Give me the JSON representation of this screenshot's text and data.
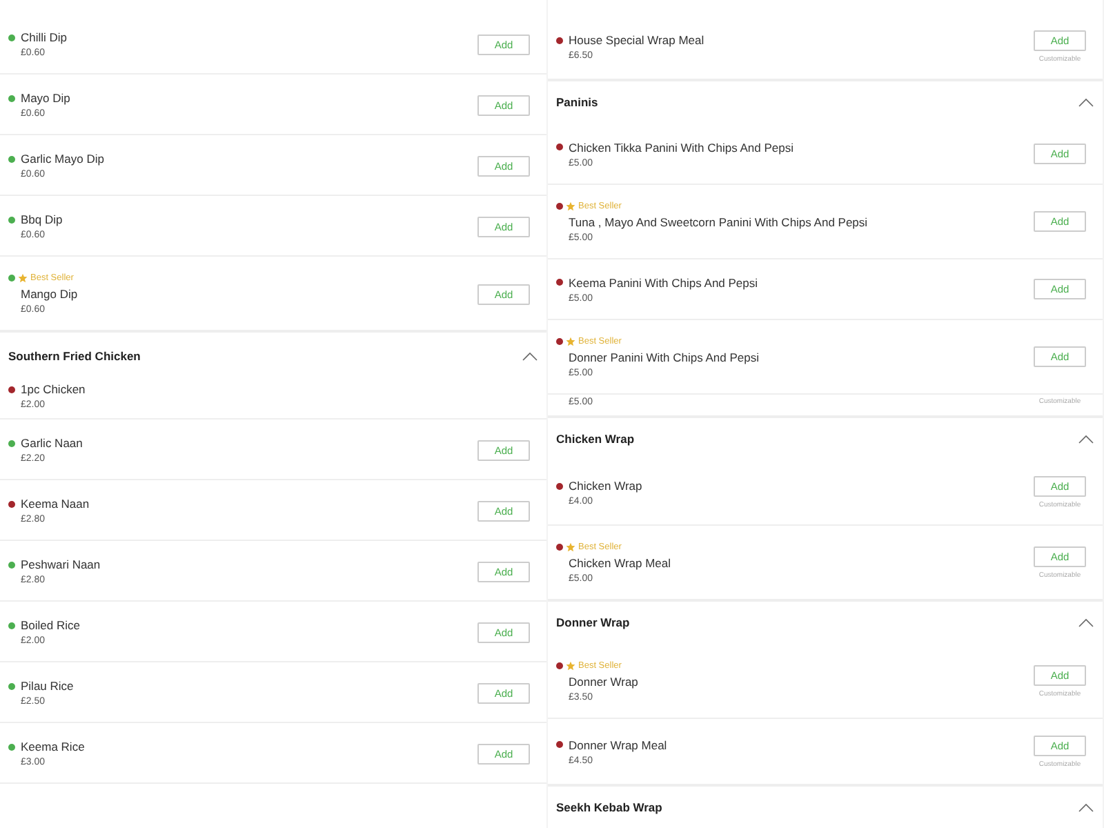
{
  "columns": [
    {
      "entries": [
        {
          "kind": "item",
          "name": "Chilli Dip",
          "price": "£0.60",
          "color": "#4caf50",
          "best_seller": false,
          "button": "Add"
        },
        {
          "kind": "item",
          "name": "Mayo Dip",
          "price": "£0.60",
          "color": "#4caf50",
          "best_seller": false,
          "button": "Add"
        },
        {
          "kind": "item",
          "name": "Garlic Mayo Dip",
          "price": "£0.60",
          "color": "#4caf50",
          "best_seller": false,
          "button": "Add"
        },
        {
          "kind": "item",
          "name": "Bbq Dip",
          "price": "£0.60",
          "color": "#4caf50",
          "best_seller": false,
          "button": "Add"
        },
        {
          "kind": "item",
          "name": "Mango Dip",
          "price": "£0.60",
          "color": "#4caf50",
          "best_seller": true,
          "badge": "Best Seller",
          "button": "Add"
        },
        {
          "kind": "section",
          "title": "Southern Fried Chicken",
          "expanded": true
        },
        {
          "kind": "cut",
          "name": "1pc Chicken",
          "price": "£2.00",
          "color": "#a3262c"
        },
        {
          "kind": "item",
          "name": "Garlic Naan",
          "price": "£2.20",
          "color": "#4caf50",
          "best_seller": false,
          "button": "Add"
        },
        {
          "kind": "item",
          "name": "Keema Naan",
          "price": "£2.80",
          "color": "#a3262c",
          "best_seller": false,
          "button": "Add"
        },
        {
          "kind": "item",
          "name": "Peshwari Naan",
          "price": "£2.80",
          "color": "#4caf50",
          "best_seller": false,
          "button": "Add"
        },
        {
          "kind": "item",
          "name": "Boiled Rice",
          "price": "£2.00",
          "color": "#4caf50",
          "best_seller": false,
          "button": "Add"
        },
        {
          "kind": "item",
          "name": "Pilau Rice",
          "price": "£2.50",
          "color": "#4caf50",
          "best_seller": false,
          "button": "Add"
        },
        {
          "kind": "item",
          "name": "Keema Rice",
          "price": "£3.00",
          "color": "#4caf50",
          "best_seller": false,
          "button": "Add"
        }
      ]
    },
    {
      "entries": [
        {
          "kind": "item",
          "name": "House Special Wrap Meal",
          "price": "£6.50",
          "color": "#a3262c",
          "best_seller": false,
          "button": "Add",
          "note": "Customizable"
        },
        {
          "kind": "section",
          "title": "Paninis",
          "expanded": true
        },
        {
          "kind": "item",
          "name": "Chicken Tikka Panini With Chips And Pepsi",
          "price": "£5.00",
          "color": "#a3262c",
          "best_seller": false,
          "button": "Add"
        },
        {
          "kind": "item",
          "name": "Tuna , Mayo And Sweetcorn Panini With Chips And Pepsi",
          "price": "£5.00",
          "color": "#a3262c",
          "best_seller": true,
          "badge": "Best Seller",
          "button": "Add"
        },
        {
          "kind": "item",
          "name": "Keema Panini With Chips And Pepsi",
          "price": "£5.00",
          "color": "#a3262c",
          "best_seller": false,
          "button": "Add"
        },
        {
          "kind": "item",
          "name": "Donner Panini With Chips And Pepsi",
          "price": "£5.00",
          "color": "#a3262c",
          "best_seller": true,
          "badge": "Best Seller",
          "button": "Add"
        },
        {
          "kind": "cut",
          "price": "£5.00",
          "note": "Customizable"
        },
        {
          "kind": "section",
          "title": "Chicken Wrap",
          "expanded": true
        },
        {
          "kind": "item",
          "name": "Chicken Wrap",
          "price": "£4.00",
          "color": "#a3262c",
          "best_seller": false,
          "button": "Add",
          "note": "Customizable"
        },
        {
          "kind": "item",
          "name": "Chicken Wrap Meal",
          "price": "£5.00",
          "color": "#a3262c",
          "best_seller": true,
          "badge": "Best Seller",
          "button": "Add",
          "note": "Customizable"
        },
        {
          "kind": "section",
          "title": "Donner Wrap",
          "expanded": true
        },
        {
          "kind": "item",
          "name": "Donner Wrap",
          "price": "£3.50",
          "color": "#a3262c",
          "best_seller": true,
          "badge": "Best Seller",
          "button": "Add",
          "note": "Customizable"
        },
        {
          "kind": "item",
          "name": "Donner Wrap Meal",
          "price": "£4.50",
          "color": "#a3262c",
          "best_seller": false,
          "button": "Add",
          "note": "Customizable"
        },
        {
          "kind": "section",
          "title": "Seekh Kebab Wrap",
          "expanded": true
        }
      ]
    }
  ]
}
